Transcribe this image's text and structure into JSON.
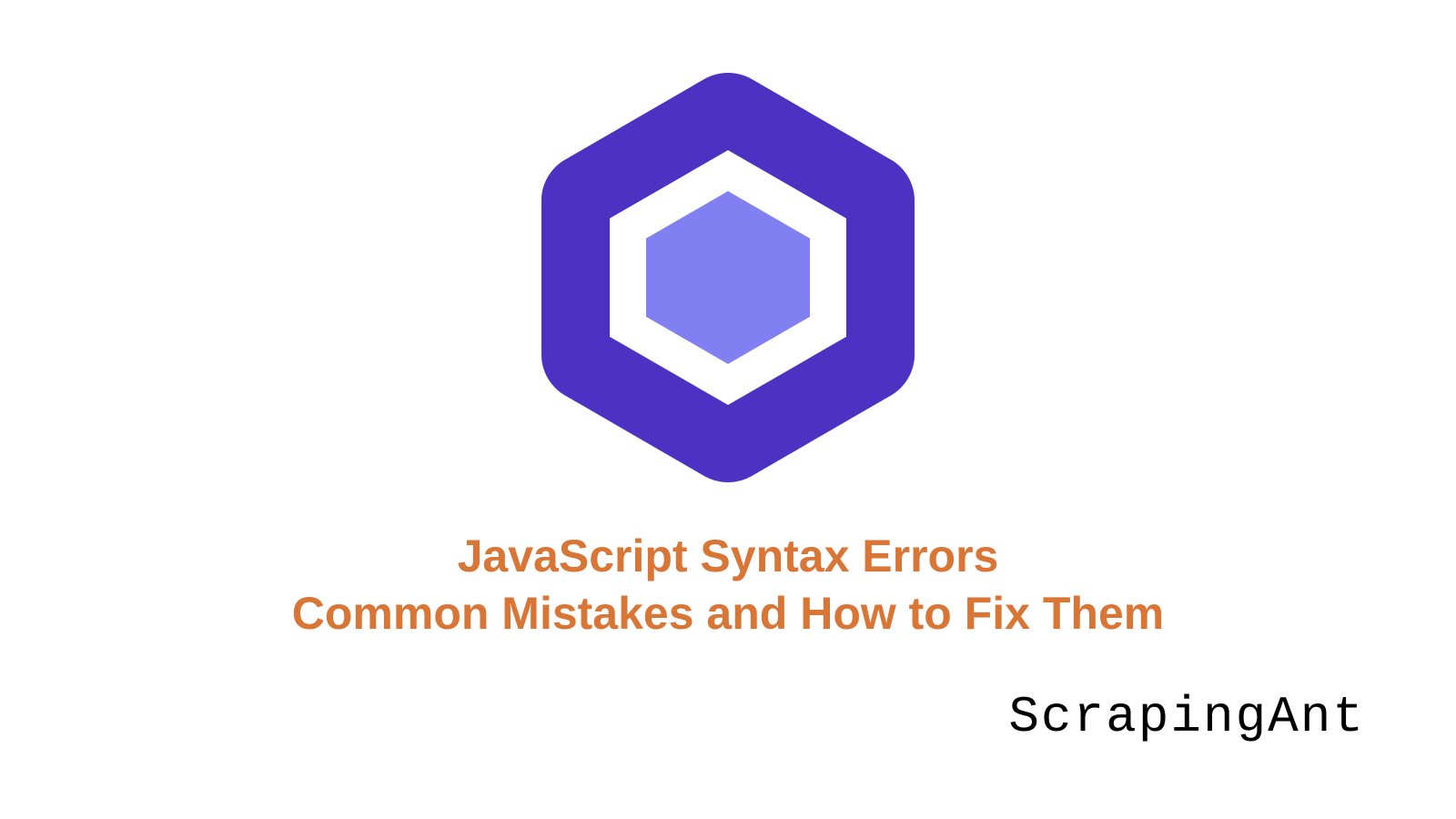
{
  "title_line1": "JavaScript Syntax Errors",
  "title_line2": "Common Mistakes and How to Fix Them",
  "brand": "ScrapingAnt",
  "colors": {
    "title": "#d97636",
    "hex_outer": "#4b32c3",
    "hex_inner": "#8080f2",
    "hex_ring": "#ffffff"
  }
}
